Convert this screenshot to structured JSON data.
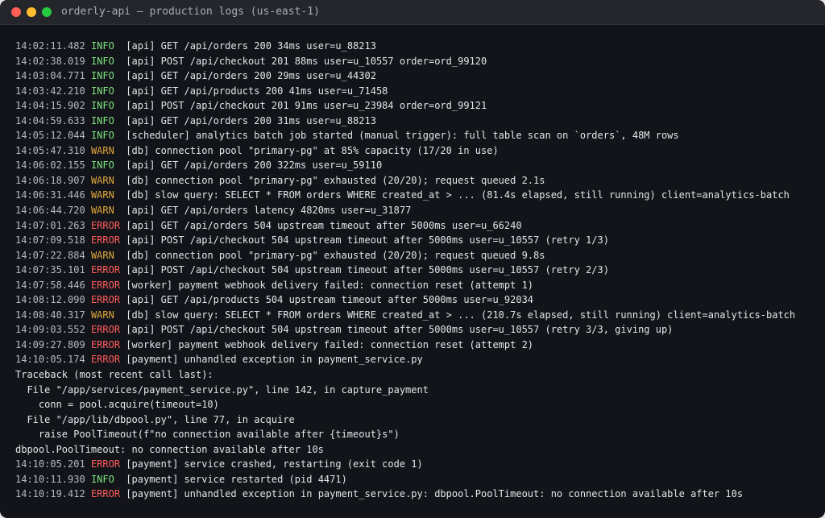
{
  "window": {
    "title": "orderly-api — production logs (us-east-1)",
    "controls": [
      "close",
      "minimize",
      "zoom"
    ]
  },
  "colors": {
    "INFO": "#7ee27e",
    "WARN": "#e0a63c",
    "ERROR": "#ff5c5c",
    "background": "#121419"
  },
  "log_lines": [
    {
      "ts": "14:02:11.482",
      "level": "INFO",
      "msg": "[api] GET /api/orders 200 34ms user=u_88213"
    },
    {
      "ts": "14:02:38.019",
      "level": "INFO",
      "msg": "[api] POST /api/checkout 201 88ms user=u_10557 order=ord_99120"
    },
    {
      "ts": "14:03:04.771",
      "level": "INFO",
      "msg": "[api] GET /api/orders 200 29ms user=u_44302"
    },
    {
      "ts": "14:03:42.210",
      "level": "INFO",
      "msg": "[api] GET /api/products 200 41ms user=u_71458"
    },
    {
      "ts": "14:04:15.902",
      "level": "INFO",
      "msg": "[api] POST /api/checkout 201 91ms user=u_23984 order=ord_99121"
    },
    {
      "ts": "14:04:59.633",
      "level": "INFO",
      "msg": "[api] GET /api/orders 200 31ms user=u_88213"
    },
    {
      "ts": "14:05:12.044",
      "level": "INFO",
      "msg": "[scheduler] analytics batch job started (manual trigger): full table scan on `orders`, 48M rows"
    },
    {
      "ts": "14:05:47.310",
      "level": "WARN",
      "msg": "[db] connection pool \"primary-pg\" at 85% capacity (17/20 in use)"
    },
    {
      "ts": "14:06:02.155",
      "level": "INFO",
      "msg": "[api] GET /api/orders 200 322ms user=u_59110"
    },
    {
      "ts": "14:06:18.907",
      "level": "WARN",
      "msg": "[db] connection pool \"primary-pg\" exhausted (20/20); request queued 2.1s"
    },
    {
      "ts": "14:06:31.446",
      "level": "WARN",
      "msg": "[db] slow query: SELECT * FROM orders WHERE created_at > ... (81.4s elapsed, still running) client=analytics-batch"
    },
    {
      "ts": "14:06:44.720",
      "level": "WARN",
      "msg": "[api] GET /api/orders latency 4820ms user=u_31877"
    },
    {
      "ts": "14:07:01.263",
      "level": "ERROR",
      "msg": "[api] GET /api/orders 504 upstream timeout after 5000ms user=u_66240"
    },
    {
      "ts": "14:07:09.518",
      "level": "ERROR",
      "msg": "[api] POST /api/checkout 504 upstream timeout after 5000ms user=u_10557 (retry 1/3)"
    },
    {
      "ts": "14:07:22.884",
      "level": "WARN",
      "msg": "[db] connection pool \"primary-pg\" exhausted (20/20); request queued 9.8s"
    },
    {
      "ts": "14:07:35.101",
      "level": "ERROR",
      "msg": "[api] POST /api/checkout 504 upstream timeout after 5000ms user=u_10557 (retry 2/3)"
    },
    {
      "ts": "14:07:58.446",
      "level": "ERROR",
      "msg": "[worker] payment webhook delivery failed: connection reset (attempt 1)"
    },
    {
      "ts": "14:08:12.090",
      "level": "ERROR",
      "msg": "[api] GET /api/products 504 upstream timeout after 5000ms user=u_92034"
    },
    {
      "ts": "14:08:40.317",
      "level": "WARN",
      "msg": "[db] slow query: SELECT * FROM orders WHERE created_at > ... (210.7s elapsed, still running) client=analytics-batch"
    },
    {
      "ts": "14:09:03.552",
      "level": "ERROR",
      "msg": "[api] POST /api/checkout 504 upstream timeout after 5000ms user=u_10557 (retry 3/3, giving up)"
    },
    {
      "ts": "14:09:27.809",
      "level": "ERROR",
      "msg": "[worker] payment webhook delivery failed: connection reset (attempt 2)"
    },
    {
      "ts": "14:10:05.174",
      "level": "ERROR",
      "msg": "[payment] unhandled exception in payment_service.py"
    },
    {
      "plain": "Traceback (most recent call last):"
    },
    {
      "plain": "  File \"/app/services/payment_service.py\", line 142, in capture_payment"
    },
    {
      "plain": "    conn = pool.acquire(timeout=10)"
    },
    {
      "plain": "  File \"/app/lib/dbpool.py\", line 77, in acquire"
    },
    {
      "plain": "    raise PoolTimeout(f\"no connection available after {timeout}s\")"
    },
    {
      "plain": "dbpool.PoolTimeout: no connection available after 10s"
    },
    {
      "ts": "14:10:05.201",
      "level": "ERROR",
      "msg": "[payment] service crashed, restarting (exit code 1)"
    },
    {
      "ts": "14:10:11.930",
      "level": "INFO",
      "msg": "[payment] service restarted (pid 4471)"
    },
    {
      "ts": "14:10:19.412",
      "level": "ERROR",
      "msg": "[payment] unhandled exception in payment_service.py: dbpool.PoolTimeout: no connection available after 10s"
    }
  ]
}
